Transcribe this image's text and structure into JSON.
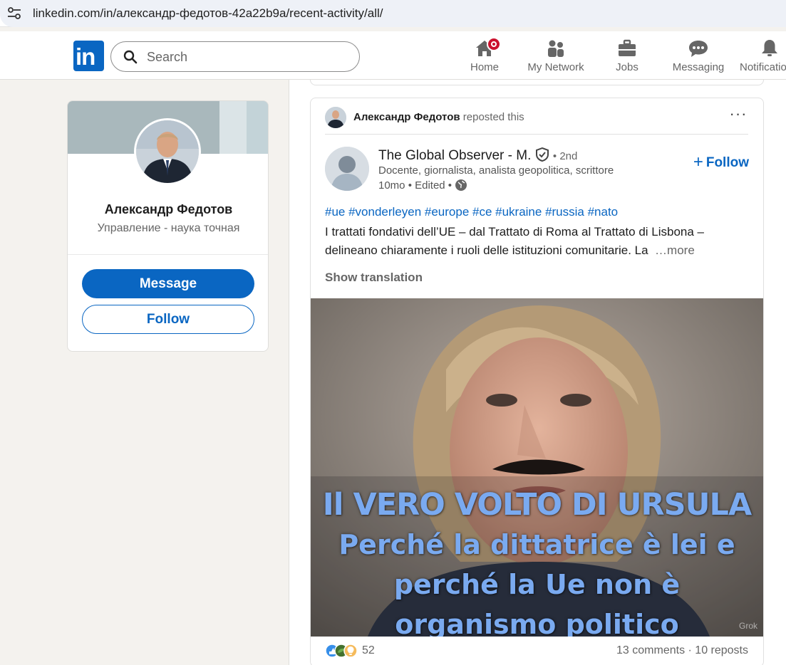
{
  "browser": {
    "url": "linkedin.com/in/александр-федотов-42a22b9a/recent-activity/all/"
  },
  "nav": {
    "logo": "in",
    "search_placeholder": "Search",
    "items": [
      {
        "label": "Home",
        "icon": "home-icon"
      },
      {
        "label": "My Network",
        "icon": "people-icon"
      },
      {
        "label": "Jobs",
        "icon": "briefcase-icon"
      },
      {
        "label": "Messaging",
        "icon": "chat-icon"
      },
      {
        "label": "Notifications",
        "icon": "bell-icon"
      }
    ]
  },
  "profile": {
    "name": "Александр Федотов",
    "headline": "Управление - наука точная",
    "message_label": "Message",
    "follow_label": "Follow"
  },
  "post": {
    "repost_name": "Александр Федотов",
    "repost_text": "reposted this",
    "more_menu": "···",
    "author_name": "The Global Observer - M.",
    "author_degree": "• 2nd",
    "author_subtitle": "Docente, giornalista, analista geopolitica, scrittore",
    "author_meta": "10mo • Edited •",
    "follow_label": "Follow",
    "hashtags": "#ue #vonderleyen #europe #ce #ukraine #russia #nato",
    "body_line1": "I trattati fondativi dell’UE – dal Trattato di Roma al Trattato di Lisbona –",
    "body_line2": "delineano chiaramente i ruoli delle istituzioni comunitarie. La",
    "more_label": "…more",
    "show_translation": "Show translation",
    "image_caption_line1": "Il VERO VOLTO DI URSULA",
    "image_caption_line2": "Perché la dittatrice è lei e",
    "image_caption_line3": "perché la Ue non è",
    "image_caption_line4": "organismo politico",
    "image_watermark": "Grok",
    "reaction_count": "52",
    "comments_reposts": "13 comments · 10 reposts"
  },
  "colors": {
    "brand": "#0a66c2",
    "page_bg": "#f4f2ee",
    "badge": "#cb112d"
  }
}
